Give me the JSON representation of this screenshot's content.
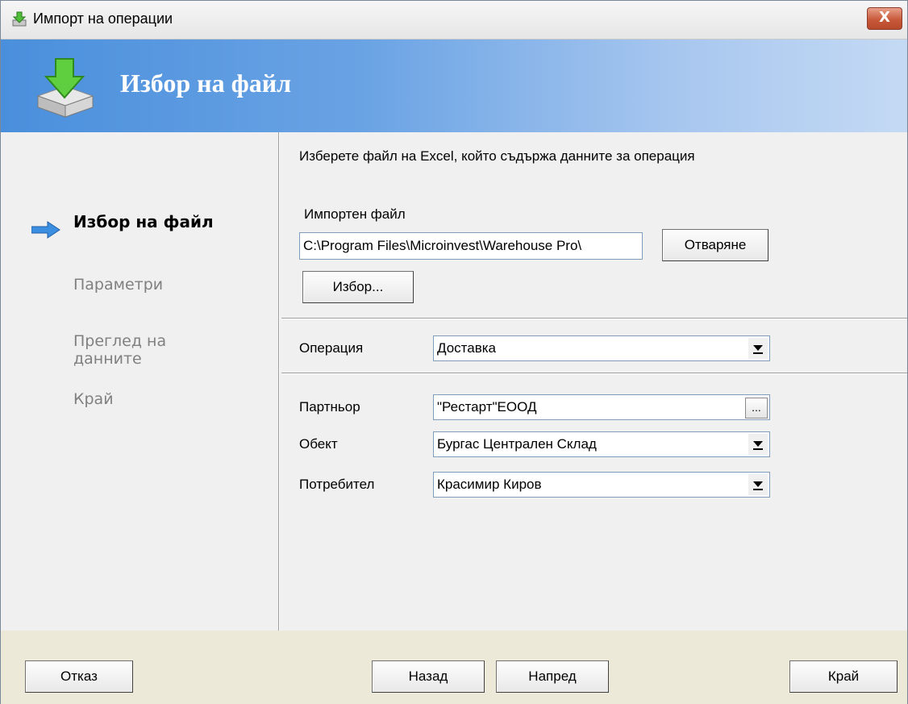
{
  "window": {
    "title": "Импорт на операции",
    "close_label": "X"
  },
  "banner": {
    "heading": "Избор на файл"
  },
  "steps": [
    {
      "label": "Избор на файл",
      "active": true
    },
    {
      "label": "Параметри",
      "active": false
    },
    {
      "label": "Преглед на данните",
      "active": false
    },
    {
      "label": "Край",
      "active": false
    }
  ],
  "content": {
    "instruction": "Изберете файл на Excel, който съдържа данните за операция",
    "file_label": "Импортен файл",
    "file_value": "C:\\Program Files\\Microinvest\\Warehouse Pro\\",
    "open_button": "Отваряне",
    "browse_button": "Избор...",
    "operation_label": "Операция",
    "operation_value": "Доставка",
    "partner_label": "Партньор",
    "partner_value": "\"Рестарт\"ЕООД",
    "partner_ellipsis": "...",
    "object_label": "Обект",
    "object_value": "Бургас Централен Склад",
    "user_label": "Потребител",
    "user_value": "Красимир Киров"
  },
  "footer": {
    "cancel": "Отказ",
    "back": "Назад",
    "next": "Напред",
    "finish": "Край"
  },
  "colors": {
    "banner_start": "#4a8fdc",
    "banner_end": "#c4daf4",
    "close": "#c85a3a",
    "arrow": "#3b8ee0"
  }
}
